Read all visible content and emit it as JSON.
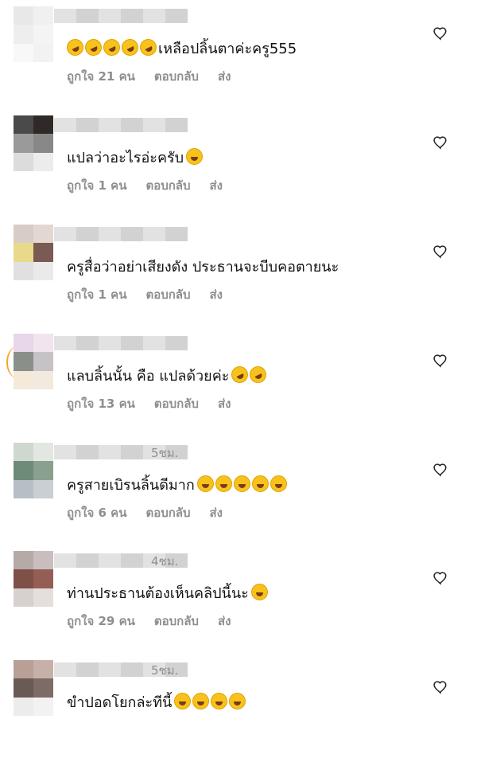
{
  "comments": [
    {
      "text": "เหลือปลิ้นตาค่ะครู555",
      "time": "",
      "likes": "ถูกใจ 21 คน",
      "reply": "ตอบกลับ",
      "send": "ส่ง",
      "emoji_before": [
        "rofl",
        "rofl",
        "rofl",
        "rofl",
        "rofl"
      ],
      "emoji_after": [],
      "avatar_colors": [
        "#e8e8e8",
        "#f0f0f0",
        "#eeeeee",
        "#f4f4f4",
        "#f8f8f8",
        "#f2f2f2"
      ]
    },
    {
      "text": "แปลว่าอะไรอ่ะครับ",
      "time": "",
      "likes": "ถูกใจ 1 คน",
      "reply": "ตอบกลับ",
      "send": "ส่ง",
      "emoji_before": [],
      "emoji_after": [
        "laugh"
      ],
      "avatar_colors": [
        "#4a4a4a",
        "#2f2a28",
        "#9a9a9a",
        "#888888",
        "#dcdcdc",
        "#ececec"
      ]
    },
    {
      "text": "ครูสื่อว่าอย่าเสียงดัง ประธานจะบีบคอตายนะ",
      "time": "",
      "likes": "ถูกใจ 1 คน",
      "reply": "ตอบกลับ",
      "send": "ส่ง",
      "emoji_before": [],
      "emoji_after": [],
      "avatar_colors": [
        "#d8ccc6",
        "#e3d7d2",
        "#e9d98a",
        "#7a5a52",
        "#e0e0e0",
        "#eaeaea"
      ]
    },
    {
      "text": "แลบลิ้นนั้น คือ แปลด้วยค่ะ",
      "time": "",
      "likes": "ถูกใจ 13 คน",
      "reply": "ตอบกลับ",
      "send": "ส่ง",
      "emoji_before": [],
      "emoji_after": [
        "rofl",
        "rofl"
      ],
      "avatar_colors": [
        "#e8d6ea",
        "#f1e4ee",
        "#8a8f8a",
        "#c7c2c6",
        "#f5e9d9",
        "#f2eadf"
      ]
    },
    {
      "text": "ครูสายเบิรนลิ้นดีมาก",
      "time": "5ชม.",
      "likes": "ถูกใจ 6 คน",
      "reply": "ตอบกลับ",
      "send": "ส่ง",
      "emoji_before": [],
      "emoji_after": [
        "laugh",
        "laugh",
        "laugh",
        "laugh",
        "laugh"
      ],
      "avatar_colors": [
        "#cfd8cf",
        "#e2e7e2",
        "#6e8a78",
        "#8aa08e",
        "#b7bec4",
        "#c9cfd2"
      ]
    },
    {
      "text": "ท่านประธานต้องเห็นคลิปนี้นะ",
      "time": "4ชม.",
      "likes": "ถูกใจ 29 คน",
      "reply": "ตอบกลับ",
      "send": "ส่ง",
      "emoji_before": [],
      "emoji_after": [
        "laugh"
      ],
      "avatar_colors": [
        "#b5aaa8",
        "#c9bebd",
        "#7e5048",
        "#955e55",
        "#d7d0cf",
        "#e4dedd"
      ]
    },
    {
      "text": "ขำปอดโยกล่ะทีนี้",
      "time": "5ชม.",
      "likes": "",
      "reply": "",
      "send": "",
      "emoji_before": [],
      "emoji_after": [
        "laugh",
        "laugh",
        "laugh",
        "laugh"
      ],
      "avatar_colors": [
        "#b9a096",
        "#c6b0a7",
        "#6a5a56",
        "#7d6b66",
        "#ececec",
        "#f2f2f2"
      ]
    }
  ]
}
